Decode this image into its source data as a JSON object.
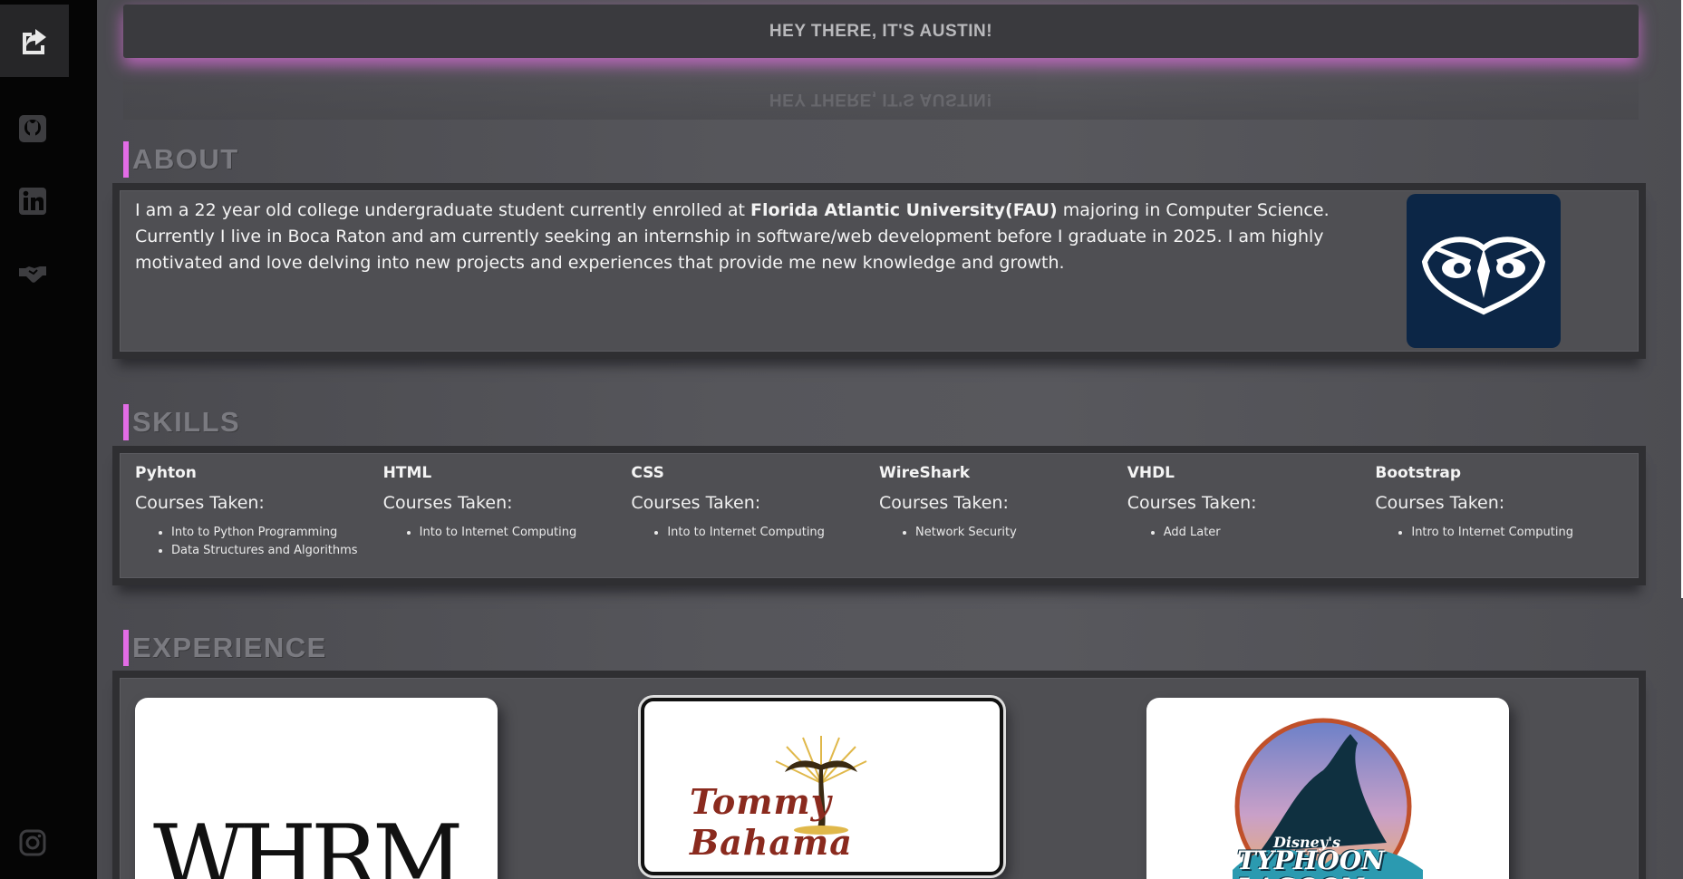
{
  "header": {
    "title": "HEY THERE, IT'S AUSTIN!"
  },
  "sidebar": {
    "items": [
      {
        "icon": "share-icon",
        "label": "Share"
      },
      {
        "icon": "github-icon",
        "label": "GitHub"
      },
      {
        "icon": "linkedin-icon",
        "label": "LinkedIn"
      },
      {
        "icon": "handshake-icon",
        "label": "Connect"
      },
      {
        "icon": "instagram-icon",
        "label": "Instagram"
      }
    ]
  },
  "about": {
    "heading": "ABOUT",
    "text_before": "I am a 22 year old college undergraduate student currently enrolled at ",
    "university": "Florida Atlantic University(FAU)",
    "text_after": " majoring in Computer Science. Currently I live in Boca Raton and am currently seeking an internship in software/web development before I graduate in 2025. I am highly motivated and love delving into new projects and experiences that provide me new knowledge and growth."
  },
  "skills": {
    "heading": "SKILLS",
    "items": [
      {
        "name": "Pyhton",
        "courses_label": "Courses Taken:",
        "courses": [
          "Into to Python Programming",
          "Data Structures and Algorithms"
        ]
      },
      {
        "name": "HTML",
        "courses_label": "Courses Taken:",
        "courses": [
          "Into to Internet Computing"
        ]
      },
      {
        "name": "CSS",
        "courses_label": "Courses Taken:",
        "courses": [
          "Into to Internet Computing"
        ]
      },
      {
        "name": "WireShark",
        "courses_label": "Courses Taken:",
        "courses": [
          "Network Security"
        ]
      },
      {
        "name": "VHDL",
        "courses_label": "Courses Taken:",
        "courses": [
          "Add Later"
        ]
      },
      {
        "name": "Bootstrap",
        "courses_label": "Courses Taken:",
        "courses": [
          "Intro to Internet Computing"
        ]
      }
    ]
  },
  "experience": {
    "heading": "EXPERIENCE",
    "cards": [
      {
        "logo_text": "WHRM"
      },
      {
        "logo_text": "Tommy Bahama"
      },
      {
        "logo_text_small": "Disney's",
        "logo_text": "TYPHOON LAGOON"
      }
    ]
  },
  "colors": {
    "accent": "#e26ce6",
    "fau_navy": "#0c2646"
  }
}
